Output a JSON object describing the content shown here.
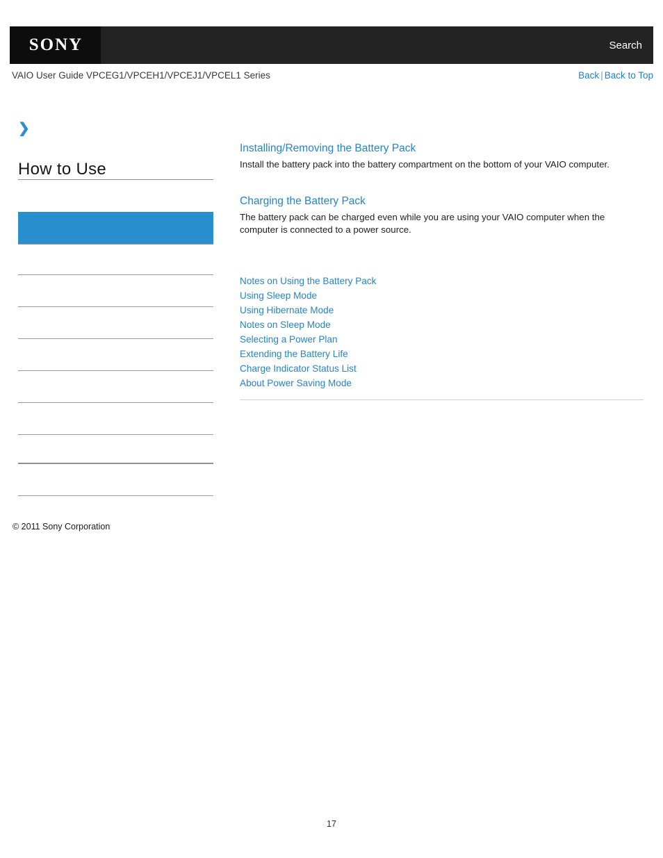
{
  "header": {
    "logo_text": "SONY",
    "search_label": "Search",
    "logo_background": "#0d0d0d",
    "bar_background": "#232323"
  },
  "subheader": {
    "title": "VAIO User Guide VPCEG1/VPCEH1/VPCEJ1/VPCEL1 Series",
    "back_label": "Back",
    "separator": "|",
    "back_to_top_label": "Back to Top",
    "link_color": "#1f7fc4"
  },
  "sidebar": {
    "chevron_icon": "❯",
    "heading": "How to Use",
    "selected_color": "#2a8fcd",
    "items": [
      {
        "label": "",
        "selected": false
      },
      {
        "label": "",
        "selected": true
      },
      {
        "label": "",
        "selected": false
      },
      {
        "label": "",
        "selected": false
      },
      {
        "label": "",
        "selected": false
      },
      {
        "label": "",
        "selected": false
      },
      {
        "label": "",
        "selected": false
      },
      {
        "label": "",
        "selected": false
      },
      {
        "label": "",
        "selected": false
      },
      {
        "label": "",
        "selected": false
      }
    ],
    "copyright": "© 2011 Sony Corporation"
  },
  "content": {
    "topics": [
      {
        "title": "Installing/Removing the Battery Pack",
        "description": "Install the battery pack into the battery compartment on the bottom of your VAIO computer."
      },
      {
        "title": "Charging the Battery Pack",
        "description": "The battery pack can be charged even while you are using your VAIO computer when the computer is connected to a power source."
      }
    ],
    "links": [
      "Notes on Using the Battery Pack",
      "Using Sleep Mode",
      "Using Hibernate Mode",
      "Notes on Sleep Mode",
      "Selecting a Power Plan",
      "Extending the Battery Life",
      "Charge Indicator Status List",
      "About Power Saving Mode"
    ],
    "link_color": "#2684c6"
  },
  "footer": {
    "page_number": "17"
  }
}
